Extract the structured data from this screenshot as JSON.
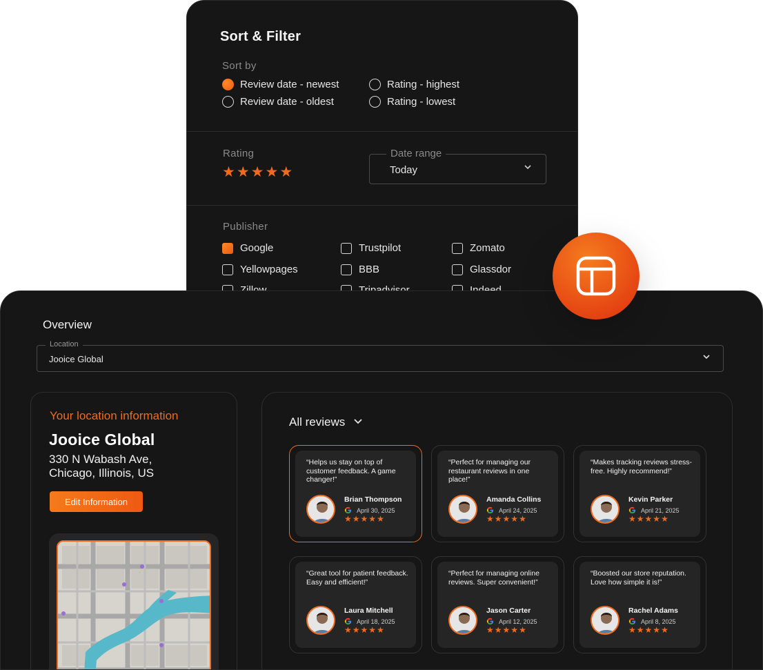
{
  "filter": {
    "title": "Sort & Filter",
    "sort_label": "Sort by",
    "sort_options": [
      {
        "label": "Review date - newest",
        "selected": true
      },
      {
        "label": "Rating - highest",
        "selected": false
      },
      {
        "label": "Review date - oldest",
        "selected": false
      },
      {
        "label": "Rating - lowest",
        "selected": false
      }
    ],
    "rating_label": "Rating",
    "rating_value": 5,
    "date_range_label": "Date range",
    "date_range_value": "Today",
    "publisher_label": "Publisher",
    "publishers": [
      {
        "label": "Google",
        "checked": true
      },
      {
        "label": "Trustpilot",
        "checked": false
      },
      {
        "label": "Zomato",
        "checked": false
      },
      {
        "label": "Yellowpages",
        "checked": false
      },
      {
        "label": "BBB",
        "checked": false
      },
      {
        "label": "Glassdor",
        "checked": false
      },
      {
        "label": "Zillow",
        "checked": false
      },
      {
        "label": "Tripadvisor",
        "checked": false
      },
      {
        "label": "Indeed",
        "checked": false
      }
    ]
  },
  "overview": {
    "title": "Overview",
    "location_label": "Location",
    "location_value": "Jooice Global"
  },
  "info": {
    "heading": "Your location information",
    "name": "Jooice Global",
    "address_line1": "330 N Wabash Ave,",
    "address_line2": "Chicago, Illinois, US",
    "edit_label": "Edit Information"
  },
  "reviews": {
    "filter_label": "All reviews",
    "items": [
      {
        "quote": "“Helps us stay on top of customer feedback. A game changer!”",
        "name": "Brian Thompson",
        "date": "April 30, 2025",
        "rating": 5
      },
      {
        "quote": "“Perfect for managing our restaurant reviews in one place!”",
        "name": "Amanda Collins",
        "date": "April 24, 2025",
        "rating": 5
      },
      {
        "quote": "“Makes tracking reviews stress-free. Highly recommend!”",
        "name": "Kevin Parker",
        "date": "April 21, 2025",
        "rating": 5
      },
      {
        "quote": "“Great tool for patient feedback. Easy and efficient!”",
        "name": "Laura Mitchell",
        "date": "April 18, 2025",
        "rating": 5
      },
      {
        "quote": "“Perfect for managing online reviews. Super convenient!”",
        "name": "Jason Carter",
        "date": "April 12, 2025",
        "rating": 5
      },
      {
        "quote": "“Boosted our store reputation. Love how simple it is!”",
        "name": "Rachel Adams",
        "date": "April 8, 2025",
        "rating": 5
      }
    ]
  },
  "colors": {
    "accent": "#f26a1b",
    "panel": "#161616",
    "card": "#252525"
  },
  "icons": {
    "floating": "layout-icon",
    "review_source": "google-icon",
    "chevron": "chevron-down-icon",
    "star": "star-icon"
  }
}
